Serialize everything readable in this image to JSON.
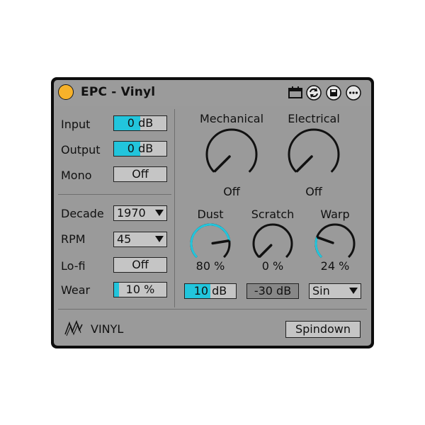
{
  "title": "EPC - Vinyl",
  "colors": {
    "accent": "#22c5dc",
    "power": "#f7b22a",
    "panel": "#9a9a9a",
    "field": "#c5c5c5"
  },
  "titlebar_icons": [
    "calendar-icon",
    "refresh-icon",
    "save-icon",
    "more-icon"
  ],
  "left": {
    "input": {
      "label": "Input",
      "value": "0 dB",
      "level": 0.5
    },
    "output": {
      "label": "Output",
      "value": "0 dB",
      "level": 0.5
    },
    "mono": {
      "label": "Mono",
      "value": "Off"
    },
    "decade": {
      "label": "Decade",
      "value": "1970"
    },
    "rpm": {
      "label": "RPM",
      "value": "45"
    },
    "lofi": {
      "label": "Lo-fi",
      "value": "Off"
    },
    "wear": {
      "label": "Wear",
      "value": "10 %",
      "level": 0.1
    }
  },
  "right": {
    "mechanical": {
      "label": "Mechanical",
      "value": "Off",
      "level": 0.0
    },
    "electrical": {
      "label": "Electrical",
      "value": "Off",
      "level": 0.0
    },
    "dust": {
      "label": "Dust",
      "value": "80 %",
      "level": 0.8,
      "amount": "10 dB",
      "amount_level": 0.5
    },
    "scratch": {
      "label": "Scratch",
      "value": "0 %",
      "level": 0.0,
      "amount": "-30 dB"
    },
    "warp": {
      "label": "Warp",
      "value": "24 %",
      "level": 0.24,
      "shape": "Sin"
    }
  },
  "footer": {
    "brand": "VINYL",
    "spindown_label": "Spindown"
  }
}
